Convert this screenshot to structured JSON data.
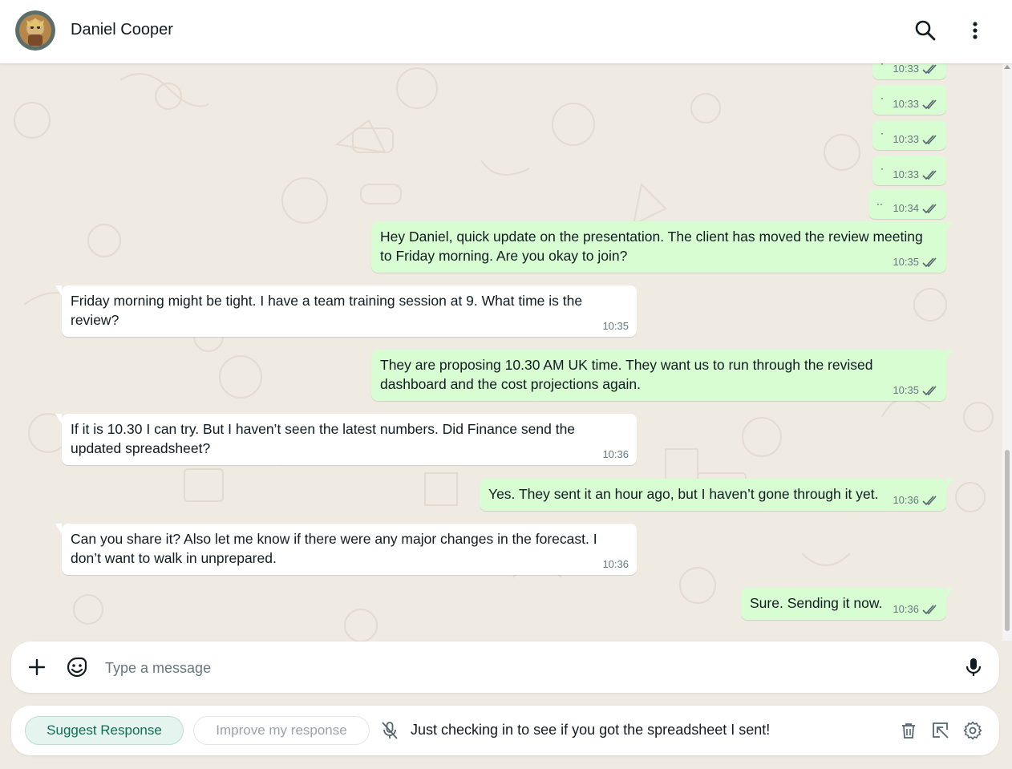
{
  "header": {
    "contact_name": "Daniel Cooper",
    "avatar_icon": "avatar-icon",
    "search_icon": "search-icon",
    "menu_icon": "more-vertical-icon"
  },
  "messages": [
    {
      "direction": "out",
      "text": "·",
      "time": "10:33",
      "status": "read"
    },
    {
      "direction": "out",
      "text": "·",
      "time": "10:33",
      "status": "read"
    },
    {
      "direction": "out",
      "text": "·",
      "time": "10:33",
      "status": "read"
    },
    {
      "direction": "out",
      "text": "·",
      "time": "10:33",
      "status": "read"
    },
    {
      "direction": "out",
      "text": "··",
      "time": "10:34",
      "status": "read"
    },
    {
      "direction": "out",
      "text": "Hey Daniel, quick update on the presentation. The client has moved the review meeting\nto Friday morning. Are you okay to join?",
      "time": "10:35",
      "status": "read"
    },
    {
      "direction": "in",
      "text": "Friday morning might be tight. I have a team training session at 9. What time is the\nreview?",
      "time": "10:35"
    },
    {
      "direction": "out",
      "text": "They are proposing 10.30 AM UK time. They want us to run through the revised\ndashboard and the cost projections again.",
      "time": "10:35",
      "status": "read"
    },
    {
      "direction": "in",
      "text": "If it is 10.30 I can try. But I haven’t seen the latest numbers. Did Finance send the\nupdated spreadsheet?",
      "time": "10:36"
    },
    {
      "direction": "out",
      "text": "Yes. They sent it an hour ago, but I haven’t gone through it yet.",
      "time": "10:36",
      "status": "read"
    },
    {
      "direction": "in",
      "text": "Can you share it? Also let me know if there were any major changes in the forecast. I\ndon’t want to walk in unprepared.",
      "time": "10:36"
    },
    {
      "direction": "out",
      "text": "Sure. Sending it now.",
      "time": "10:36",
      "status": "read"
    }
  ],
  "composer": {
    "placeholder": "Type a message",
    "value": "",
    "attach_icon": "plus-icon",
    "sticker_icon": "sticker-icon",
    "mic_icon": "microphone-icon"
  },
  "assistant": {
    "suggest_label": "Suggest Response",
    "improve_label": "Improve my response",
    "suggestion_text": "Just checking in to see if you got the spreadsheet I sent!",
    "mic_off_icon": "microphone-off-icon",
    "delete_icon": "trash-icon",
    "insert_icon": "insert-arrow-icon",
    "settings_icon": "gear-icon"
  },
  "colors": {
    "outgoing_bubble": "#d9fdd3",
    "incoming_bubble": "#ffffff",
    "chat_background": "#efeae2",
    "read_ticks": "#53bdeb",
    "accent": "#0d6e55"
  }
}
